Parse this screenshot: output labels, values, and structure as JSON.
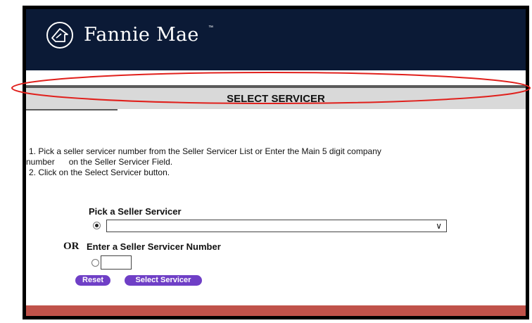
{
  "header": {
    "brand": "Fannie Mae",
    "trademark": "™",
    "brand_color": "#0b1a36"
  },
  "page": {
    "title": "SELECT SERVICER"
  },
  "instructions": {
    "line1": "1. Pick a seller servicer number from the Seller Servicer List or Enter the Main 5 digit company",
    "line2": "number      on the Seller Servicer Field.",
    "line3": "2. Click on the Select Servicer button."
  },
  "form": {
    "pick_label": "Pick a Seller Servicer",
    "or_label": "OR",
    "enter_label": "Enter a Seller Servicer Number",
    "select_value": "",
    "number_value": "",
    "pick_selected": true,
    "enter_selected": false
  },
  "buttons": {
    "reset_label": "Reset",
    "select_label": "Select Servicer",
    "accent_color": "#6f3fc6"
  },
  "footer": {
    "color": "#c0524a"
  },
  "annotation": {
    "color": "#e0201c"
  }
}
